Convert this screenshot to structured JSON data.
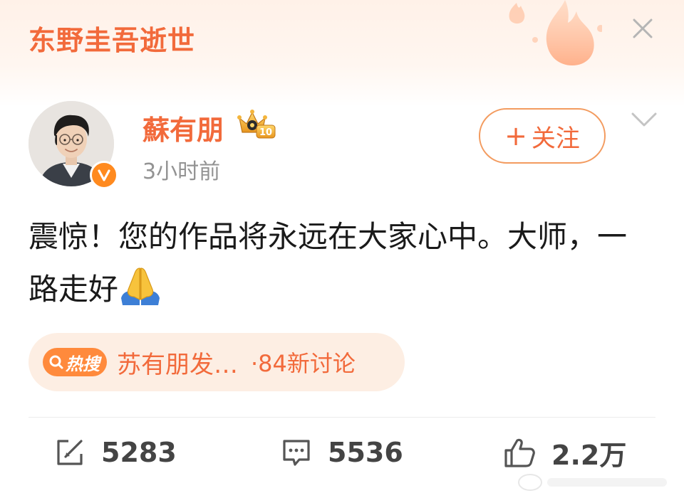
{
  "topic": {
    "title": "东野圭吾逝世"
  },
  "author": {
    "name": "蘇有朋",
    "time": "3小时前",
    "vip_level": "10",
    "avatar": "avatar-man-with-glasses"
  },
  "follow_button": {
    "plus": "+",
    "label": "关注"
  },
  "post": {
    "text": "震惊！您的作品将永远在大家心中。大师，一路走好",
    "emoji": "folded-hands-emoji"
  },
  "hot_search": {
    "badge": "热搜",
    "topic": "苏有朋发…",
    "count": "·84新讨论"
  },
  "actions": {
    "repost_count": "5283",
    "comment_count": "5536",
    "like_count": "2.2万"
  },
  "colors": {
    "accent": "#f26a3b",
    "verify": "#ff8a1f",
    "text": "#1a1a1a",
    "muted": "#939393"
  }
}
